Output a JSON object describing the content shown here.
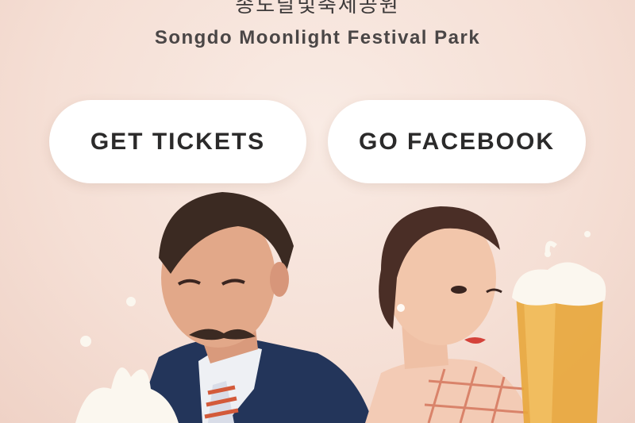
{
  "venue": {
    "name_ko": "송도달빛축제공원",
    "name_en": "Songdo Moonlight Festival Park"
  },
  "buttons": {
    "tickets_label": "GET TICKETS",
    "facebook_label": "GO FACEBOOK"
  },
  "colors": {
    "background": "#f6e3da",
    "button_bg": "#ffffff",
    "button_text": "#2b2a2a",
    "beer": "#e8a63a",
    "suit": "#23355a"
  }
}
